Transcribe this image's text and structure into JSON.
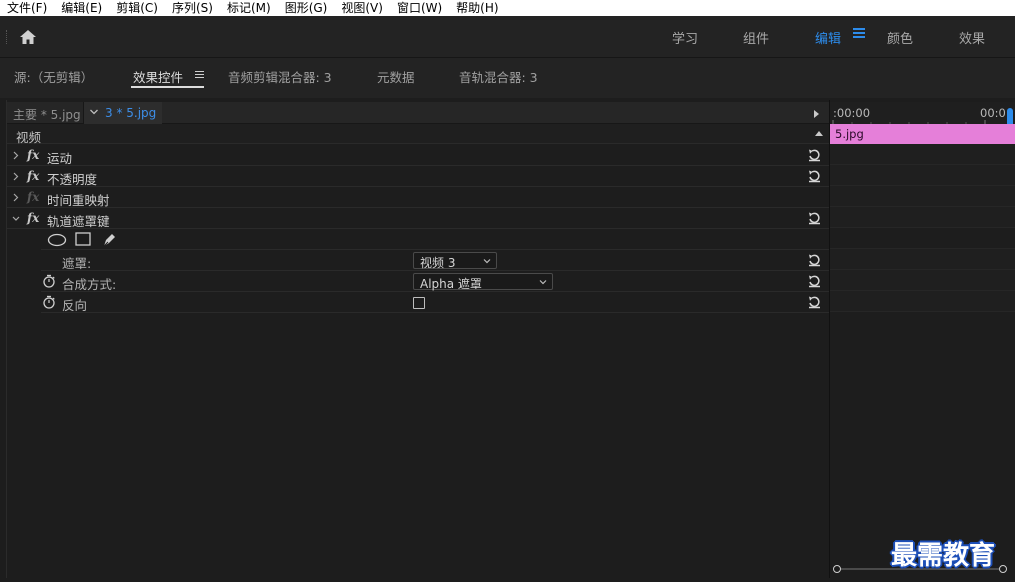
{
  "menu": [
    "文件(F)",
    "编辑(E)",
    "剪辑(C)",
    "序列(S)",
    "标记(M)",
    "图形(G)",
    "视图(V)",
    "窗口(W)",
    "帮助(H)"
  ],
  "workspaces": {
    "learn": "学习",
    "assembly": "组件",
    "editing": "编辑",
    "color": "颜色",
    "effects": "效果",
    "active": "编辑",
    "active_color": "#2d8ceb"
  },
  "panel_tabs": {
    "source": "源:（无剪辑）",
    "effect_controls": "效果控件",
    "audio_clip_mixer": "音频剪辑混合器: 3",
    "metadata": "元数据",
    "audio_track_mixer": "音轨混合器: 3"
  },
  "clip_bar": {
    "master": "主要 * 5.jpg",
    "sequence_clip": "3 * 5.jpg"
  },
  "section": {
    "video_label": "视频"
  },
  "effects": [
    {
      "name": "运动",
      "fx_enabled": true
    },
    {
      "name": "不透明度",
      "fx_enabled": true
    },
    {
      "name": "时间重映射",
      "fx_enabled": false
    },
    {
      "name": "轨道遮罩键",
      "fx_enabled": true,
      "expanded": true
    }
  ],
  "track_matte": {
    "matte_label": "遮罩:",
    "matte_value": "视频 3",
    "composite_label": "合成方式:",
    "composite_value": "Alpha 遮罩",
    "reverse_label": "反向",
    "reverse_checked": false
  },
  "timeline": {
    "start_time": ":00:00",
    "end_time": "00:0",
    "clip_name": "5.jpg",
    "clip_color": "#e57fd9"
  },
  "watermark": "最需教育"
}
